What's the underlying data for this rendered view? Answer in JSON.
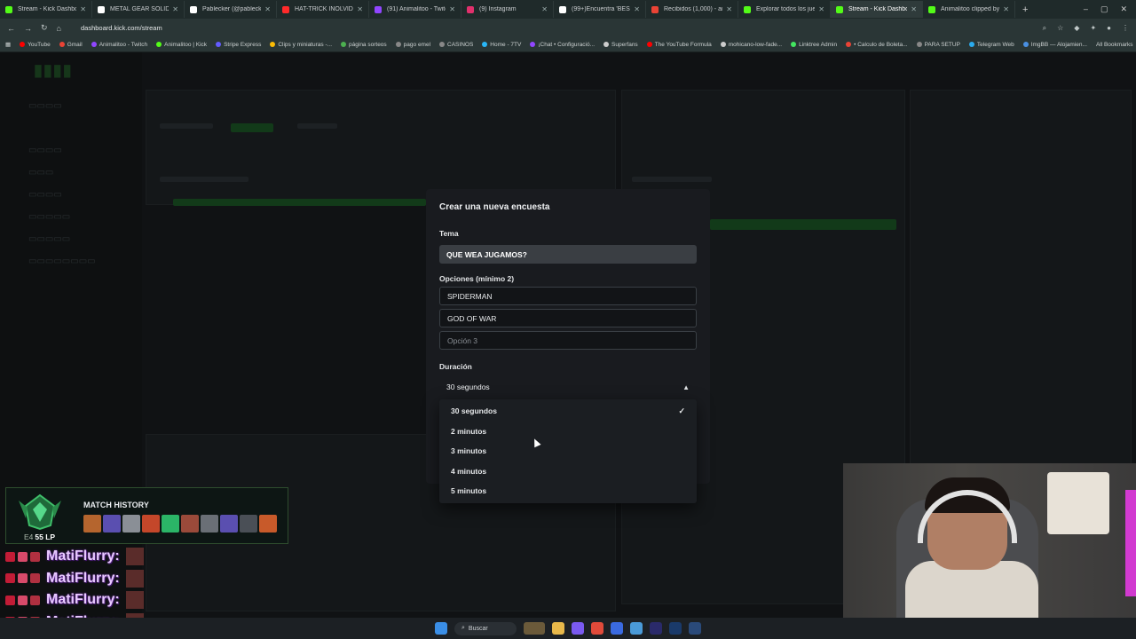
{
  "browser": {
    "tabs": [
      {
        "label": "Stream - Kick Dashboard",
        "color": "#53fc18"
      },
      {
        "label": "METAL GEAR SOLID & SH",
        "color": "#ffffff"
      },
      {
        "label": "Pablecker (@pablecker) |",
        "color": "#ffffff"
      },
      {
        "label": "HAT-TRICK INOLVIDA",
        "color": "#ff2a2a"
      },
      {
        "label": "(91) Animalitoo - Twitch",
        "color": "#9146ff"
      },
      {
        "label": "(9) Instagram",
        "color": "#e1306c"
      },
      {
        "label": "(99+)Encuentra 'BESO KA",
        "color": "#ffffff"
      },
      {
        "label": "Recibidos (1,000) - anim",
        "color": "#ea4335"
      },
      {
        "label": "Explorar todos los juego",
        "color": "#53fc18"
      },
      {
        "label": "Stream - Kick Dashboard",
        "color": "#53fc18"
      },
      {
        "label": "Animalitoo clipped by Cr",
        "color": "#53fc18"
      }
    ],
    "url": "dashboard.kick.com/stream",
    "bookmarks": [
      {
        "label": "YouTube",
        "color": "#ff0000"
      },
      {
        "label": "Gmail",
        "color": "#ea4335"
      },
      {
        "label": "Animalitoo - Twitch",
        "color": "#9146ff"
      },
      {
        "label": "Animalitoo | Kick",
        "color": "#53fc18"
      },
      {
        "label": "Stripe Express",
        "color": "#635bff"
      },
      {
        "label": "Clips y miniaturas -...",
        "color": "#fbbc05"
      },
      {
        "label": "página sorteos",
        "color": "#4caf50"
      },
      {
        "label": "pago emel",
        "color": "#888888"
      },
      {
        "label": "CASINOS",
        "color": "#888888"
      },
      {
        "label": "Home - 7TV",
        "color": "#29b6f6"
      },
      {
        "label": "¡Chat • Configuració...",
        "color": "#9146ff"
      },
      {
        "label": "Superfans",
        "color": "#cccccc"
      },
      {
        "label": "The YouTube Formula",
        "color": "#ff0000"
      },
      {
        "label": "mohicano-low-fade...",
        "color": "#cccccc"
      },
      {
        "label": "Linktree Admin",
        "color": "#43e660"
      },
      {
        "label": "• Calculo de Boleta...",
        "color": "#ea4335"
      },
      {
        "label": "PARA SETUP",
        "color": "#888888"
      },
      {
        "label": "Telegram Web",
        "color": "#2aabee"
      },
      {
        "label": "ImgBB — Alojamien...",
        "color": "#4a90e2"
      }
    ],
    "all_bookmarks": "All Bookmarks"
  },
  "modal": {
    "title": "Crear una nueva encuesta",
    "topic_label": "Tema",
    "topic_value": "QUE WEA JUGAMOS?",
    "options_label": "Opciones (mínimo 2)",
    "options": [
      "SPIDERMAN",
      "GOD OF WAR"
    ],
    "option3_placeholder": "Opción 3",
    "duration_label": "Duración",
    "duration_value": "30 segundos",
    "duration_options": [
      "30 segundos",
      "2 minutos",
      "3 minutos",
      "4 minutos",
      "5 minutos"
    ]
  },
  "overlay": {
    "match_history_title": "MATCH HISTORY",
    "rank_tier": "E4",
    "rank_lp": "55 LP",
    "chat_names": [
      "MatiFlurry:",
      "MatiFlurry:",
      "MatiFlurry:",
      "MatiFlurry:"
    ],
    "champion_colors": [
      "#b5652e",
      "#5a4fb0",
      "#8a8f96",
      "#c4472a",
      "#2bb567",
      "#9a4a3a",
      "#6a6f76",
      "#5a4fb0",
      "#4a4f56",
      "#c85a2a"
    ]
  },
  "taskbar": {
    "search_label": "Buscar"
  }
}
